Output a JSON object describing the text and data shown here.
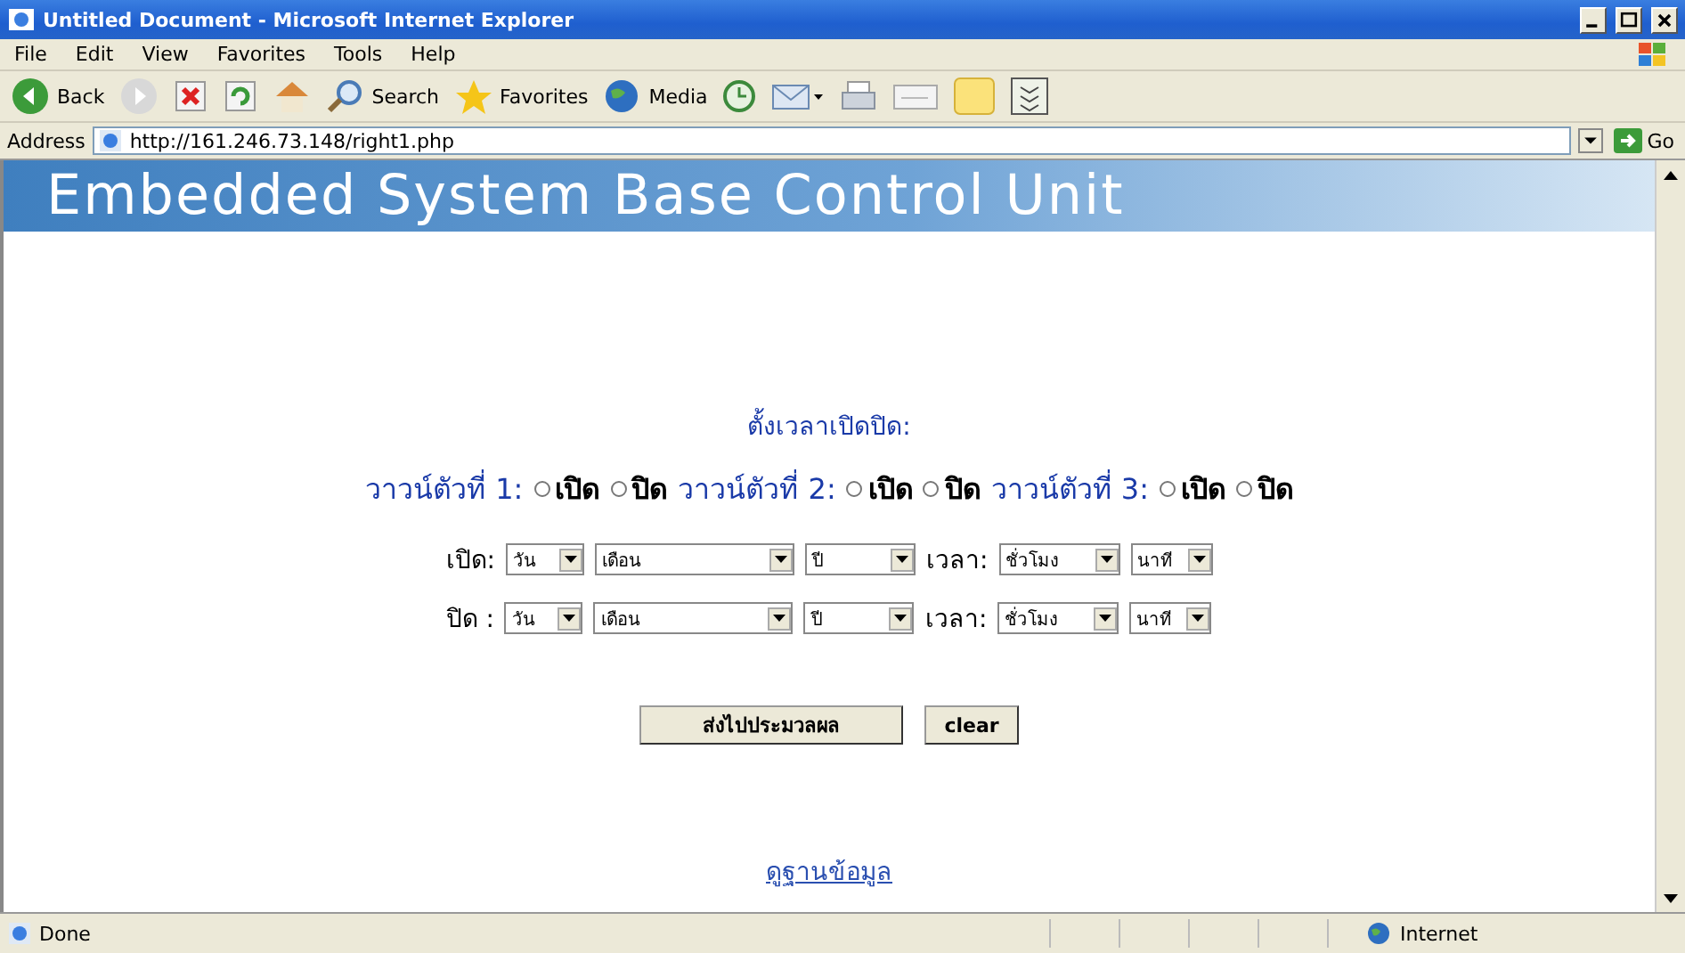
{
  "window": {
    "title": "Untitled Document - Microsoft Internet Explorer"
  },
  "menu": [
    "File",
    "Edit",
    "View",
    "Favorites",
    "Tools",
    "Help"
  ],
  "toolbar": [
    {
      "kind": "back",
      "label": "Back"
    },
    {
      "kind": "forward"
    },
    {
      "kind": "stop"
    },
    {
      "kind": "refresh"
    },
    {
      "kind": "home"
    },
    {
      "kind": "search",
      "label": "Search"
    },
    {
      "kind": "favorites",
      "label": "Favorites"
    },
    {
      "kind": "media",
      "label": "Media"
    },
    {
      "kind": "history"
    },
    {
      "kind": "mail"
    },
    {
      "kind": "print"
    },
    {
      "kind": "edit"
    },
    {
      "kind": "folder"
    },
    {
      "kind": "messenger"
    }
  ],
  "address": {
    "label": "Address",
    "value": "http://161.246.73.148/right1.php",
    "go": "Go"
  },
  "page": {
    "banner": "Embedded System Base Control Unit",
    "heading": "ตั้งเวลาเปิดปิด:",
    "valves": [
      {
        "label": "วาวน์ตัวที่ 1:",
        "options": [
          {
            "label": "เปิด",
            "selected": false
          },
          {
            "label": "ปิด",
            "selected": false
          }
        ]
      },
      {
        "label": "วาวน์ตัวที่ 2:",
        "options": [
          {
            "label": "เปิด",
            "selected": false
          },
          {
            "label": "ปิด",
            "selected": false
          }
        ]
      },
      {
        "label": "วาวน์ตัวที่ 3:",
        "options": [
          {
            "label": "เปิด",
            "selected": false
          },
          {
            "label": "ปิด",
            "selected": false
          }
        ]
      }
    ],
    "schedule": [
      {
        "label": "เปิด:",
        "date": [
          "วัน",
          "เดือน",
          "ปี"
        ],
        "time_label": "เวลา:",
        "time": [
          "ชั่วโมง",
          "นาที"
        ]
      },
      {
        "label": "ปิด :",
        "date": [
          "วัน",
          "เดือน",
          "ปี"
        ],
        "time_label": "เวลา:",
        "time": [
          "ชั่วโมง",
          "นาที"
        ]
      }
    ],
    "buttons": [
      "ส่งไปประมวลผล",
      "clear"
    ],
    "link": "ดูฐานข้อมูล"
  },
  "status": {
    "text": "Done",
    "zone": "Internet"
  }
}
